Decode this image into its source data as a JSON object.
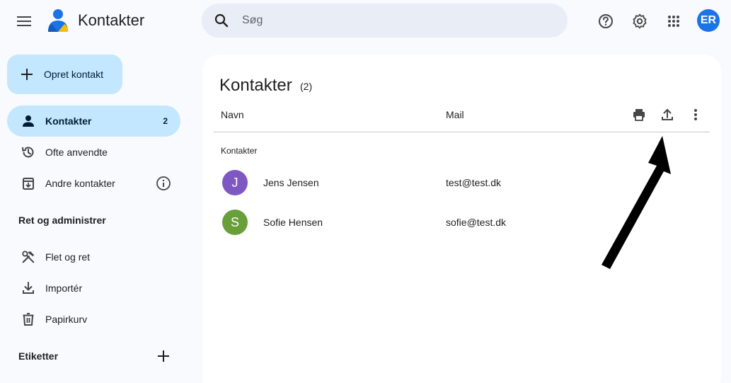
{
  "header": {
    "app_title": "Kontakter",
    "search_placeholder": "Søg",
    "account_initials": "ER",
    "account_color": "#1a73e8",
    "icons": [
      "menu-icon",
      "contacts-logo-icon",
      "search-icon",
      "help-icon",
      "settings-icon",
      "apps-grid-icon"
    ]
  },
  "sidebar": {
    "create_button": "Opret kontakt",
    "items": [
      {
        "label": "Kontakter",
        "count": "2",
        "icon": "person-icon",
        "active": true
      },
      {
        "label": "Ofte anvendte",
        "icon": "history-icon"
      },
      {
        "label": "Andre kontakter",
        "icon": "archive-icon",
        "info_icon": "info-icon"
      }
    ],
    "manage_heading": "Ret og administrer",
    "manage_items": [
      {
        "label": "Flet og ret",
        "icon": "tools-icon"
      },
      {
        "label": "Importér",
        "icon": "download-icon"
      },
      {
        "label": "Papirkurv",
        "icon": "trash-icon"
      }
    ],
    "labels_heading": "Etiketter"
  },
  "main": {
    "title": "Kontakter",
    "count": "(2)",
    "columns": {
      "name": "Navn",
      "mail": "Mail"
    },
    "toolbar_icons": [
      "print-icon",
      "export-icon",
      "more-vert-icon"
    ],
    "group_label": "Kontakter",
    "contacts": [
      {
        "initial": "J",
        "name": "Jens Jensen",
        "mail": "test@test.dk",
        "color": "#7e57c2"
      },
      {
        "initial": "S",
        "name": "Sofie Hensen",
        "mail": "sofie@test.dk",
        "color": "#689f38"
      }
    ]
  },
  "colors": {
    "background": "#f8fafd",
    "accent_light": "#c2e7ff",
    "search_bg": "#e9eef6",
    "panel": "#ffffff",
    "annotation_arrow": "#000000"
  }
}
